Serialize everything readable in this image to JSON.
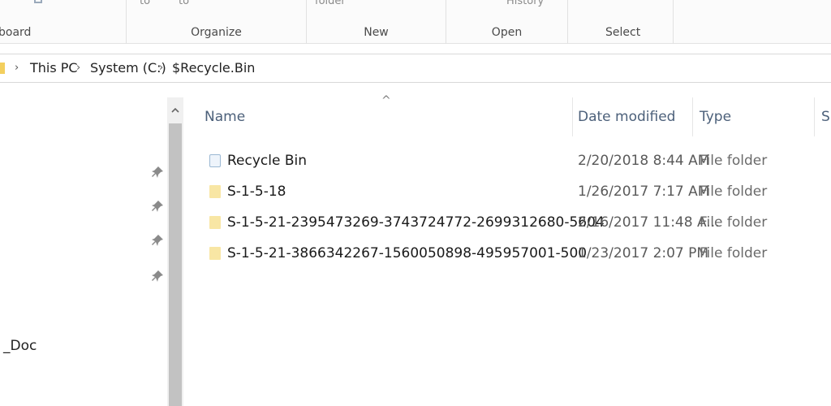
{
  "ribbon": {
    "groups": [
      {
        "label": "board",
        "top": ""
      },
      {
        "label": "Organize",
        "top_left": "to",
        "top_right": "to"
      },
      {
        "label": "New",
        "top": "folder"
      },
      {
        "label": "Open",
        "top": "History"
      },
      {
        "label": "Select"
      }
    ]
  },
  "address": {
    "crumbs": [
      "This PC",
      "System (C:)",
      "$Recycle.Bin"
    ],
    "chevron": "›"
  },
  "nav": {
    "item_label": "_Doc",
    "pin_count": 4
  },
  "columns": {
    "name": "Name",
    "date": "Date modified",
    "type": "Type",
    "size": "Si"
  },
  "rows": [
    {
      "name": "Recycle Bin",
      "date": "2/20/2018 8:44 AM",
      "type": "File folder",
      "icon": "recycle-bin-icon"
    },
    {
      "name": "S-1-5-18",
      "date": "1/26/2017 7:17 AM",
      "type": "File folder",
      "icon": "folder-icon"
    },
    {
      "name": "S-1-5-21-2395473269-3743724772-2699312680-5604",
      "date": "2/16/2017 11:48 A...",
      "type": "File folder",
      "icon": "folder-icon"
    },
    {
      "name": "S-1-5-21-3866342267-1560050898-495957001-500",
      "date": "1/23/2017 2:07 PM",
      "type": "File folder",
      "icon": "folder-icon"
    }
  ],
  "colors": {
    "folder": "#f8e6a4",
    "header_text": "#4c607a",
    "scroll_thumb": "#c2c2c2"
  }
}
